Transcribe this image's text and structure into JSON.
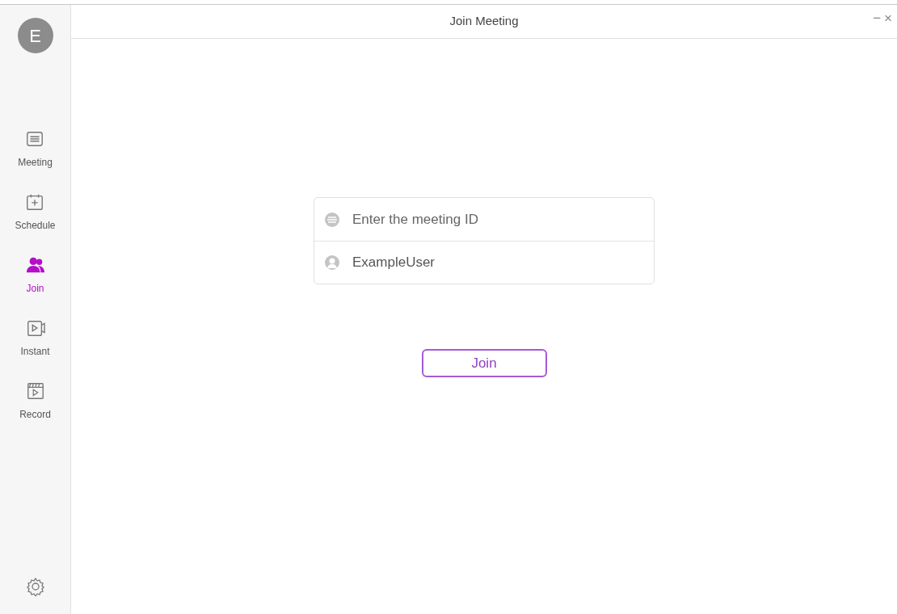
{
  "window": {
    "title": "Join Meeting",
    "controls": [
      "−",
      "×"
    ]
  },
  "avatar": {
    "initial": "E"
  },
  "sidebar": {
    "items": [
      {
        "kind": "meeting",
        "label": "Meeting",
        "selected": false
      },
      {
        "kind": "schedule",
        "label": "Schedule",
        "selected": false
      },
      {
        "kind": "join",
        "label": "Join",
        "selected": true
      },
      {
        "kind": "instant",
        "label": "Instant",
        "selected": false
      },
      {
        "kind": "record",
        "label": "Record",
        "selected": false
      }
    ]
  },
  "form": {
    "fields": [
      {
        "kind": "meeting-id",
        "placeholder": "Enter the meeting ID"
      },
      {
        "kind": "user",
        "value": "ExampleUser"
      }
    ],
    "button": "Join"
  }
}
